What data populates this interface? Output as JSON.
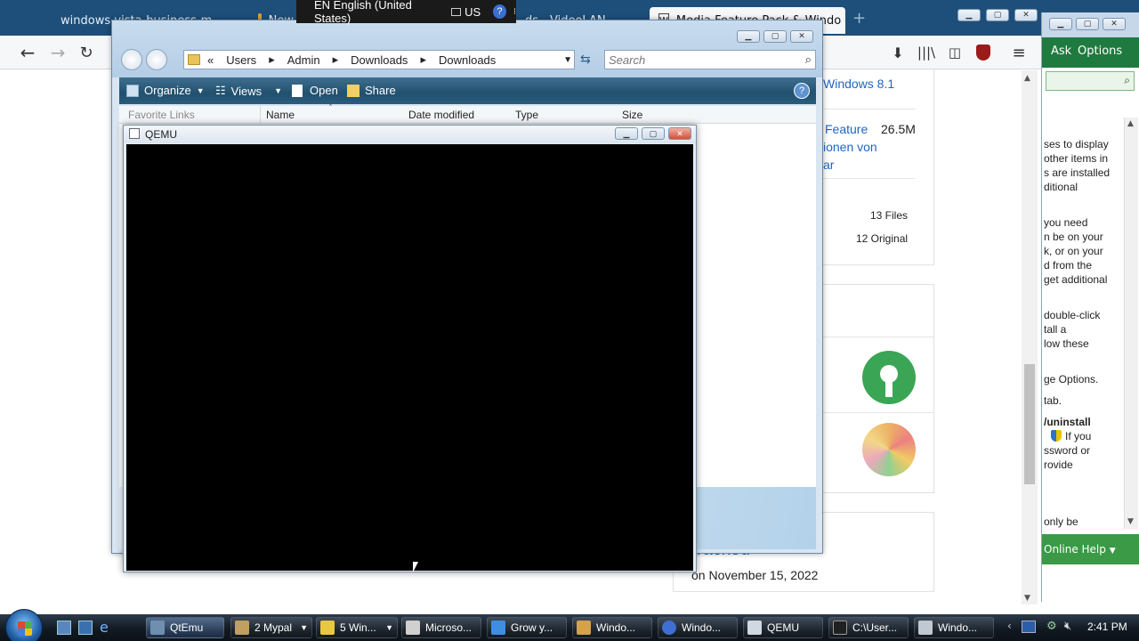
{
  "browser": {
    "tabs": [
      {
        "label": "windows-vista-business-m...",
        "icon": "globe-icon",
        "color": "#d9442e"
      },
      {
        "label": "New",
        "icon": "star-icon",
        "color": "#e0a12b"
      },
      {
        "label": "ds - VideoLAN",
        "icon": "vlc-icon",
        "color": "#f08c00"
      },
      {
        "label": "Media Feature Pack & Windo",
        "icon": "wiki-icon",
        "color": "#111111"
      }
    ],
    "ask_label": "Ask",
    "options_label": "Options"
  },
  "web": {
    "snippet_windows81": "Windows 8.1",
    "snippet_feature": "Feature",
    "snippet_size": "26.5M",
    "snippet_lionen": "ionen von",
    "snippet_ar": "ar",
    "files_count": "13 Files",
    "original_count": "12 Original",
    "cracked_fragment": "racked",
    "date_text": "on November 15, 2022"
  },
  "help_panel": {
    "lines": [
      "ses to display",
      "other items in",
      "s are installed",
      "ditional",
      "you need",
      "n be on your",
      "k, or on your",
      "d from the",
      "get additional",
      "double-click",
      "tall a",
      "low these",
      "ge Options.",
      "tab.",
      "/uninstall",
      "If you",
      "ssword or",
      "rovide",
      "only be"
    ],
    "online_help": "Online Help"
  },
  "explorer": {
    "breadcrumb": [
      "Users",
      "Admin",
      "Downloads",
      "Downloads"
    ],
    "search_placeholder": "Search",
    "commands": {
      "organize": "Organize",
      "views": "Views",
      "open": "Open",
      "share": "Share"
    },
    "favorite_links": "Favorite Links",
    "columns": [
      "Name",
      "Date modified",
      "Type",
      "Size"
    ]
  },
  "qemu": {
    "title": "QEMU"
  },
  "langbar": {
    "language": "EN English (United States)",
    "layout": "US"
  },
  "taskbar": {
    "items": [
      {
        "label": "QtEmu",
        "color": "#6f8fb0"
      },
      {
        "label": "2 Mypal",
        "color": "#c0a060"
      },
      {
        "label": "5 Win...",
        "color": "#e8c840"
      },
      {
        "label": "Microso...",
        "color": "#d0d0d0"
      },
      {
        "label": "Grow y...",
        "color": "#3f8ee0"
      },
      {
        "label": "Windo...",
        "color": "#d4a24a"
      },
      {
        "label": "Windo...",
        "color": "#3f6fd0"
      },
      {
        "label": "QEMU",
        "color": "#d0d8e0"
      },
      {
        "label": "C:\\User...",
        "color": "#202020"
      },
      {
        "label": "Windo...",
        "color": "#c0c8d0"
      }
    ],
    "clock": "2:41 PM"
  }
}
